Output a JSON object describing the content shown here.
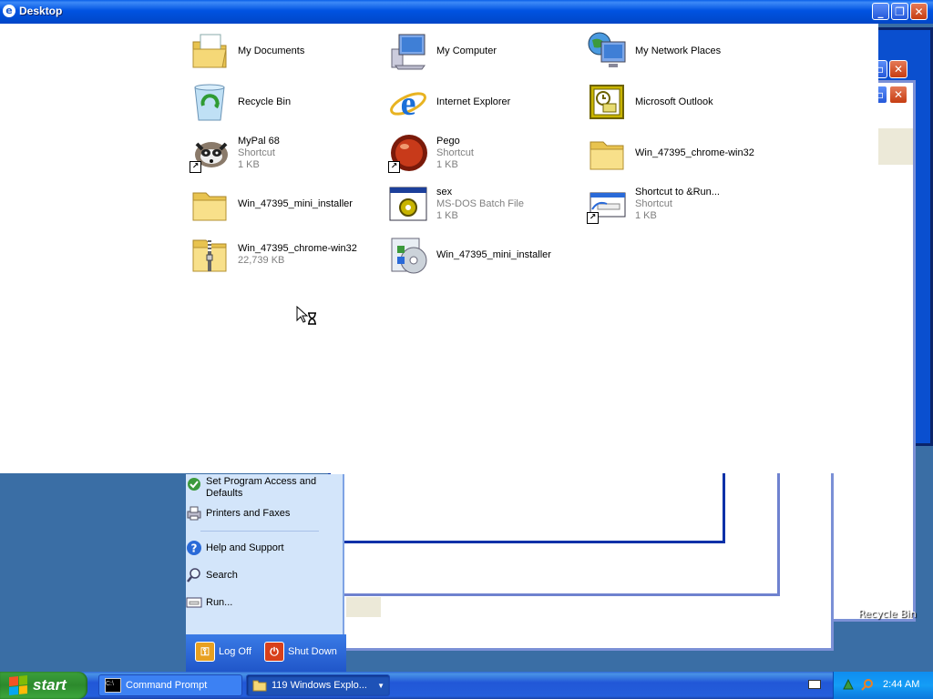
{
  "window": {
    "title": "Desktop",
    "controls": [
      "minimize",
      "restore",
      "close"
    ]
  },
  "items": [
    {
      "name": "My Documents",
      "icon": "my-documents-icon",
      "shortcut": false
    },
    {
      "name": "My Computer",
      "icon": "my-computer-icon",
      "shortcut": false
    },
    {
      "name": "My Network Places",
      "icon": "network-places-icon",
      "shortcut": false
    },
    {
      "name": "Recycle Bin",
      "icon": "recycle-bin-icon",
      "shortcut": false
    },
    {
      "name": "Internet Explorer",
      "icon": "internet-explorer-icon",
      "shortcut": false
    },
    {
      "name": "Microsoft Outlook",
      "icon": "outlook-icon",
      "shortcut": false
    },
    {
      "name": "MyPal 68",
      "type": "Shortcut",
      "size": "1 KB",
      "icon": "mypal-raccoon-icon",
      "shortcut": true
    },
    {
      "name": "Pego",
      "type": "Shortcut",
      "size": "1 KB",
      "icon": "pego-red-ball-icon",
      "shortcut": true
    },
    {
      "name": "Win_47395_chrome-win32",
      "icon": "folder-icon",
      "shortcut": false
    },
    {
      "name": "Win_47395_mini_installer",
      "icon": "folder-icon",
      "shortcut": false
    },
    {
      "name": "sex",
      "type": "MS-DOS Batch File",
      "size": "1 KB",
      "icon": "batch-file-icon",
      "shortcut": false
    },
    {
      "name": "Shortcut to &Run...",
      "type": "Shortcut",
      "size": "1 KB",
      "icon": "run-dialog-icon",
      "shortcut": true
    },
    {
      "name": "Win_47395_chrome-win32",
      "type": "",
      "size": "22,739 KB",
      "icon": "zip-folder-icon",
      "shortcut": false
    },
    {
      "name": "Win_47395_mini_installer",
      "icon": "installer-icon",
      "shortcut": false
    }
  ],
  "start_menu": {
    "items": [
      {
        "label": "Set Program Access and Defaults",
        "icon": "program-access-icon"
      },
      {
        "label": "Printers and Faxes",
        "icon": "printer-icon"
      },
      {
        "label": "Help and Support",
        "icon": "help-icon"
      },
      {
        "label": "Search",
        "icon": "search-icon"
      },
      {
        "label": "Run...",
        "icon": "run-icon"
      }
    ],
    "log_off": "Log Off",
    "shut_down": "Shut Down"
  },
  "desktop": {
    "recycle_bin_label": "Recycle Bin"
  },
  "taskbar": {
    "start_label": "start",
    "tasks": [
      {
        "label": "Command Prompt",
        "icon": "command-prompt-icon",
        "active": false
      },
      {
        "label": "119 Windows Explo...",
        "icon": "folder-icon",
        "active": true
      }
    ],
    "clock": "2:44 AM"
  },
  "colors": {
    "titlebar": "#0054e3",
    "taskbar": "#245edb",
    "start_button": "#3c9f3c",
    "tray": "#0f8df0"
  }
}
